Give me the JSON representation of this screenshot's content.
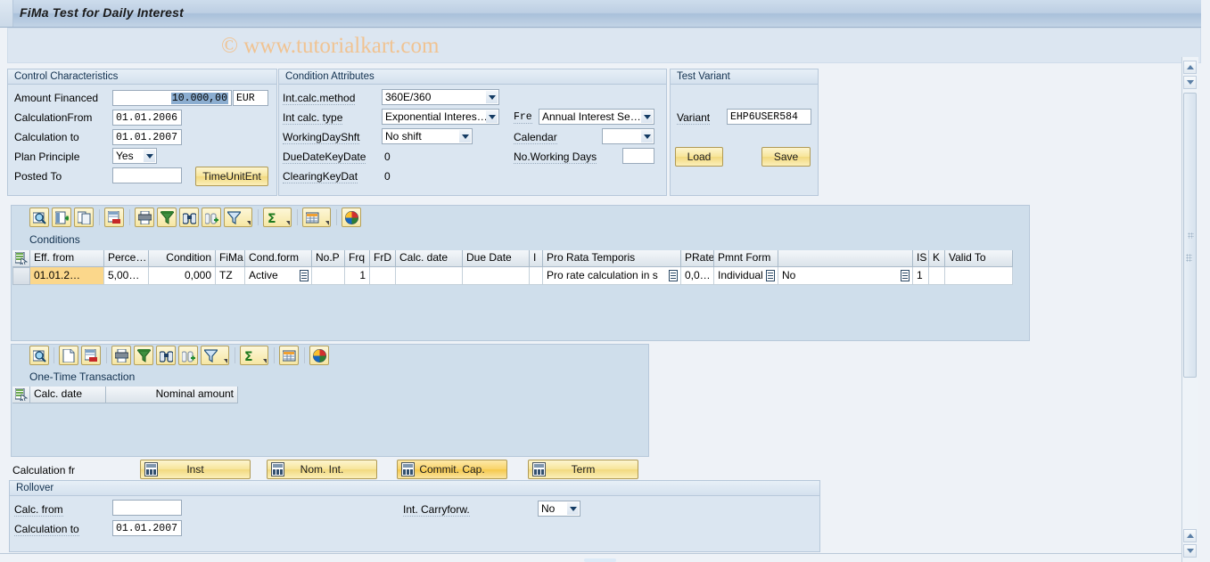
{
  "window": {
    "title": "FiMa Test for Daily Interest",
    "watermark": "© www.tutorialkart.com"
  },
  "control_characteristics": {
    "title": "Control Characteristics",
    "fields": {
      "amount_financed_label": "Amount Financed",
      "amount_financed_value": "10.000,00",
      "currency_value": "EUR",
      "calculation_from_label": "CalculationFrom",
      "calculation_from_value": "01.01.2006",
      "calculation_to_label": "Calculation to",
      "calculation_to_value": "01.01.2007",
      "plan_principle_label": "Plan Principle",
      "plan_principle_value": "Yes",
      "posted_to_label": "Posted To",
      "posted_to_value": ""
    },
    "time_unit_button": "TimeUnitEnt"
  },
  "condition_attributes": {
    "title": "Condition Attributes",
    "fields": {
      "int_calc_method_label": "Int.calc.method",
      "int_calc_method_value": "360E/360",
      "int_calc_type_label": "Int calc. type",
      "int_calc_type_value": "Exponential Interes…",
      "working_day_shift_label": "WorkingDayShft",
      "working_day_shift_value": "No shift",
      "due_date_key_date_label": "DueDateKeyDate",
      "due_date_key_date_value": "0",
      "clearing_key_date_label": "ClearingKeyDat",
      "clearing_key_date_value": "0",
      "frequency_label": "Fre",
      "frequency_value": "Annual Interest Se…",
      "calendar_label": "Calendar",
      "calendar_value": "",
      "no_working_days_label": "No.Working Days",
      "no_working_days_value": ""
    }
  },
  "test_variant": {
    "title": "Test Variant",
    "variant_label": "Variant",
    "variant_value": "EHP6USER584",
    "load_button": "Load",
    "save_button": "Save"
  },
  "conditions_toolbar": {
    "buttons": [
      {
        "name": "detail-magnifier-icon",
        "tip": "Display detail"
      },
      {
        "name": "insert-row-icon",
        "tip": "Insert row"
      },
      {
        "name": "copy-row-icon",
        "tip": "Copy row"
      },
      {
        "name": "delete-row-icon",
        "tip": "Delete row"
      },
      {
        "name": "print-icon",
        "tip": "Print"
      },
      {
        "name": "filter-funnel-icon",
        "tip": "Set filter"
      },
      {
        "name": "find-icon",
        "tip": "Find"
      },
      {
        "name": "find-next-icon",
        "tip": "Find next"
      },
      {
        "name": "filter-icon",
        "tip": "Filter"
      },
      {
        "name": "sum-sigma-icon",
        "tip": "Total"
      },
      {
        "name": "layout-grid-icon",
        "tip": "Select layout"
      },
      {
        "name": "graphic-palette-icon",
        "tip": "Graphic"
      }
    ]
  },
  "conditions": {
    "title": "Conditions",
    "columns": [
      "Eff. from",
      "Perce…",
      "Condition",
      "FiMa",
      "Cond.form",
      "No.P",
      "Frq",
      "FrD",
      "Calc. date",
      "Due Date",
      "I",
      "Pro Rata Temporis",
      "PRate",
      "Pmnt Form",
      "",
      "IS",
      "K",
      "Valid To"
    ],
    "rows": [
      {
        "eff_from": "01.01.2…",
        "percentage": "5,00…",
        "condition": "0,000",
        "fima": "TZ",
        "cond_form": "Active",
        "no_p": "",
        "frq": "1",
        "frd": "",
        "calc_date": "",
        "due_date": "",
        "i": "",
        "pro_rata_temporis": "Pro rate calculation in s",
        "prate": "0,0…",
        "pmnt_form": "Individual",
        "extra": "No",
        "is": "1",
        "k": "",
        "valid_to": ""
      }
    ]
  },
  "onetime_toolbar": {
    "buttons": [
      {
        "name": "detail-magnifier-icon",
        "tip": "Display detail"
      },
      {
        "name": "new-row-icon",
        "tip": "Create row"
      },
      {
        "name": "delete-row-icon",
        "tip": "Delete row"
      },
      {
        "name": "print-icon",
        "tip": "Print"
      },
      {
        "name": "filter-funnel-icon",
        "tip": "Set filter"
      },
      {
        "name": "find-icon",
        "tip": "Find"
      },
      {
        "name": "find-next-icon",
        "tip": "Find next"
      },
      {
        "name": "filter-icon",
        "tip": "Filter"
      },
      {
        "name": "sum-sigma-icon",
        "tip": "Total"
      },
      {
        "name": "layout-grid-icon",
        "tip": "Select layout"
      },
      {
        "name": "graphic-palette-icon",
        "tip": "Graphic"
      }
    ]
  },
  "onetime_transaction": {
    "title": "One-Time Transaction",
    "columns": [
      "Calc. date",
      "Nominal amount"
    ],
    "rows": []
  },
  "calculation_bar": {
    "label": "Calculation fr",
    "buttons": [
      {
        "label": "Inst",
        "active": false
      },
      {
        "label": "Nom. Int.",
        "active": false
      },
      {
        "label": "Commit. Cap.",
        "active": true
      },
      {
        "label": "Term",
        "active": false
      }
    ]
  },
  "rollover": {
    "title": "Rollover",
    "calc_from_label": "Calc. from",
    "calc_from_value": "",
    "calculation_to_label": "Calculation to",
    "calculation_to_value": "01.01.2007",
    "int_carryforward_label": "Int. Carryforw.",
    "int_carryforward_value": "No"
  },
  "colors": {
    "title_bar": "#bdcfe3",
    "panel_bg": "#dbe6f1",
    "accent_yellow": "#f7e59a",
    "required_cell": "#fbd78b",
    "watermark": "#f0c392"
  }
}
